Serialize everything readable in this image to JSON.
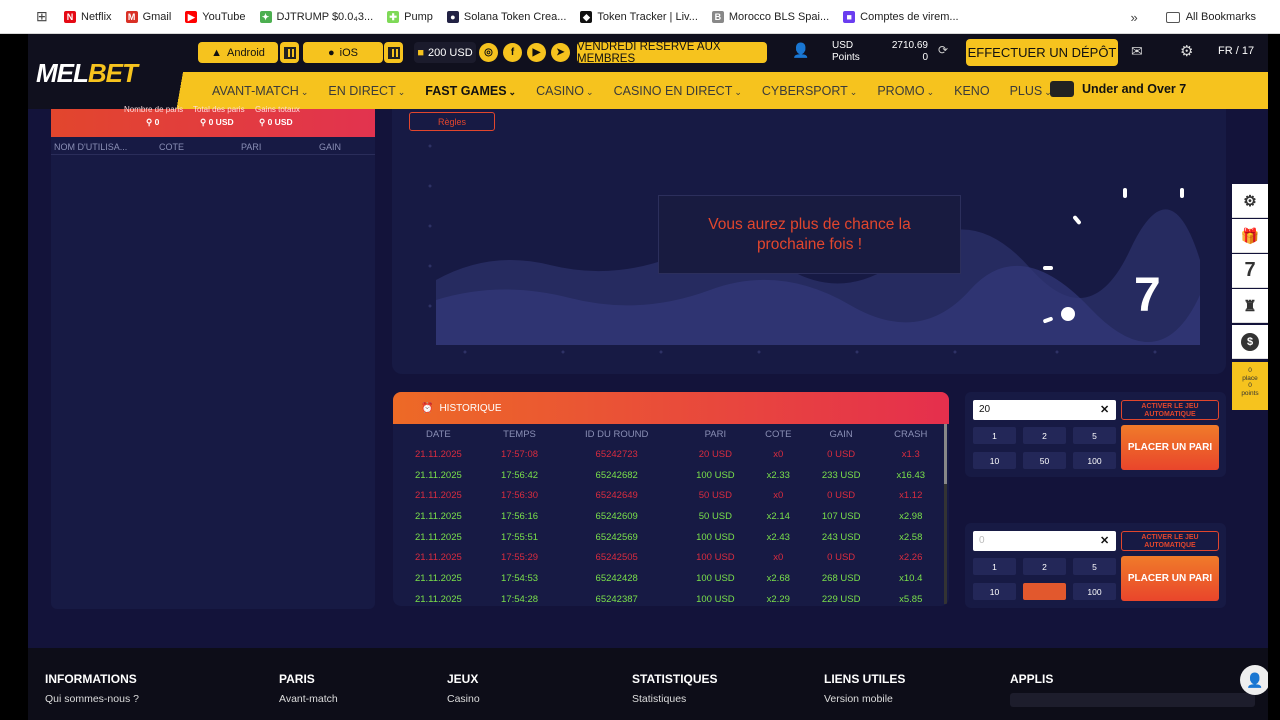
{
  "bookmarks": {
    "items": [
      {
        "label": "Netflix",
        "icon_color": "#e50914",
        "glyph": "N"
      },
      {
        "label": "Gmail",
        "icon_color": "#d93025",
        "glyph": "M"
      },
      {
        "label": "YouTube",
        "icon_color": "#ff0000",
        "glyph": "▶"
      },
      {
        "label": "DJTRUMP $0.0₄3...",
        "icon_color": "#4caf50",
        "glyph": "✦"
      },
      {
        "label": "Pump",
        "icon_color": "#7ed957",
        "glyph": "✚"
      },
      {
        "label": "Solana Token Crea...",
        "icon_color": "#222244",
        "glyph": "●"
      },
      {
        "label": "Token Tracker | Liv...",
        "icon_color": "#111111",
        "glyph": "◆"
      },
      {
        "label": "Morocco BLS Spai...",
        "icon_color": "#888888",
        "glyph": "B"
      },
      {
        "label": "Comptes de virem...",
        "icon_color": "#6a3df0",
        "glyph": "■"
      }
    ],
    "overflow": "»",
    "all": "All Bookmarks"
  },
  "header": {
    "logo_main": "MEL",
    "logo_accent": "BET",
    "android": "Android",
    "ios": "iOS",
    "bonus": "200 USD",
    "promo_banner": "VENDREDI RÉSERVÉ AUX MEMBRES",
    "currency": "USD",
    "points_label": "Points",
    "balance": "2710.69",
    "points": "0",
    "deposit": "EFFECTUER UN DÉPÔT",
    "lang": "FR / 17"
  },
  "nav": {
    "items": [
      {
        "label": "AVANT-MATCH"
      },
      {
        "label": "EN DIRECT"
      },
      {
        "label": "FAST GAMES"
      },
      {
        "label": "CASINO"
      },
      {
        "label": "CASINO EN DIRECT"
      },
      {
        "label": "CYBERSPORT"
      },
      {
        "label": "PROMO"
      },
      {
        "label": "KENO"
      },
      {
        "label": "PLUS"
      }
    ],
    "featured": "Under and Over 7"
  },
  "left_panel": {
    "stats_labels": [
      "Nombre de paris",
      "Total des paris",
      "Gains totaux"
    ],
    "stats_values": [
      "0",
      "0 USD",
      "0 USD"
    ],
    "columns": [
      "NOM D'UTILISA...",
      "COTE",
      "PARI",
      "GAIN"
    ]
  },
  "game": {
    "rules": "Règles",
    "message_line1": "Vous aurez plus de chance la",
    "message_line2": "prochaine fois !",
    "countdown": "7"
  },
  "history": {
    "title": "HISTORIQUE",
    "columns": [
      "DATE",
      "TEMPS",
      "ID DU ROUND",
      "PARI",
      "COTE",
      "GAIN",
      "CRASH"
    ],
    "rows": [
      {
        "status": "lose",
        "cells": [
          "21.11.2025",
          "17:57:08",
          "65242723",
          "20 USD",
          "x0",
          "0 USD",
          "x1.3"
        ]
      },
      {
        "status": "win",
        "cells": [
          "21.11.2025",
          "17:56:42",
          "65242682",
          "100 USD",
          "x2.33",
          "233 USD",
          "x16.43"
        ]
      },
      {
        "status": "lose",
        "cells": [
          "21.11.2025",
          "17:56:30",
          "65242649",
          "50 USD",
          "x0",
          "0 USD",
          "x1.12"
        ]
      },
      {
        "status": "win",
        "cells": [
          "21.11.2025",
          "17:56:16",
          "65242609",
          "50 USD",
          "x2.14",
          "107 USD",
          "x2.98"
        ]
      },
      {
        "status": "win",
        "cells": [
          "21.11.2025",
          "17:55:51",
          "65242569",
          "100 USD",
          "x2.43",
          "243 USD",
          "x2.58"
        ]
      },
      {
        "status": "lose",
        "cells": [
          "21.11.2025",
          "17:55:29",
          "65242505",
          "100 USD",
          "x0",
          "0 USD",
          "x2.26"
        ]
      },
      {
        "status": "win",
        "cells": [
          "21.11.2025",
          "17:54:53",
          "65242428",
          "100 USD",
          "x2.68",
          "268 USD",
          "x10.4"
        ]
      },
      {
        "status": "win",
        "cells": [
          "21.11.2025",
          "17:54:28",
          "65242387",
          "100 USD",
          "x2.29",
          "229 USD",
          "x5.85"
        ]
      }
    ]
  },
  "bet1": {
    "value": "20",
    "auto": "ACTIVER LE JEU AUTOMATIQUE",
    "quick": [
      "1",
      "2",
      "5",
      "10",
      "50",
      "100"
    ],
    "place": "PLACER UN PARI"
  },
  "bet2": {
    "placeholder": "0",
    "auto": "ACTIVER LE JEU AUTOMATIQUE",
    "quick": [
      "1",
      "2",
      "5",
      "10",
      "",
      "100"
    ],
    "place": "PLACER UN PARI"
  },
  "side": {
    "points_box": [
      "0",
      "place",
      "0",
      "points"
    ],
    "icons": [
      "settings-icon",
      "gift-icon",
      "seven-icon",
      "badge-icon",
      "dollar-icon"
    ]
  },
  "footer": {
    "columns": [
      {
        "title": "INFORMATIONS",
        "link": "Qui sommes-nous ?"
      },
      {
        "title": "PARIS",
        "link": "Avant-match"
      },
      {
        "title": "JEUX",
        "link": "Casino"
      },
      {
        "title": "STATISTIQUES",
        "link": "Statistiques"
      },
      {
        "title": "LIENS UTILES",
        "link": "Version mobile"
      },
      {
        "title": "APPLIS",
        "link": ""
      }
    ]
  }
}
